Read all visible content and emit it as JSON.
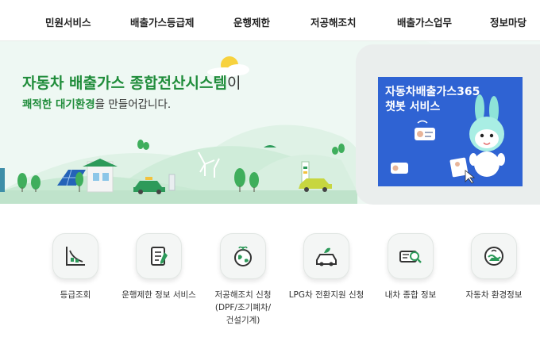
{
  "nav": {
    "items": [
      "민원서비스",
      "배출가스등급제",
      "운행제한",
      "저공해조치",
      "배출가스업무",
      "정보마당"
    ]
  },
  "hero": {
    "title_strong": "자동차 배출가스 종합전산시스템",
    "title_tail": "이",
    "sub_strong": "쾌적한 대기환경",
    "sub_tail": "을 만들어갑니다."
  },
  "chatbot": {
    "line1": "자동차배출가스365",
    "line2": "챗봇 서비스"
  },
  "quick_menu": [
    {
      "label": "등급조회",
      "icon": "grade-chart-icon"
    },
    {
      "label": "운행제한 정보 서비스",
      "icon": "document-pen-icon"
    },
    {
      "label": "저공해조치 신청\n(DPF/조기폐차/\n건설기계)",
      "icon": "earth-sprout-icon"
    },
    {
      "label": "LPG차 전환지원 신청",
      "icon": "car-leaf-icon"
    },
    {
      "label": "내차 종합 정보",
      "icon": "car-magnifier-icon"
    },
    {
      "label": "자동차 환경정보",
      "icon": "eco-globe-icon"
    }
  ],
  "colors": {
    "brand_green": "#1f8c3a",
    "chatbot_blue": "#2f63d3",
    "hero_bg": "#f1f9f6"
  }
}
